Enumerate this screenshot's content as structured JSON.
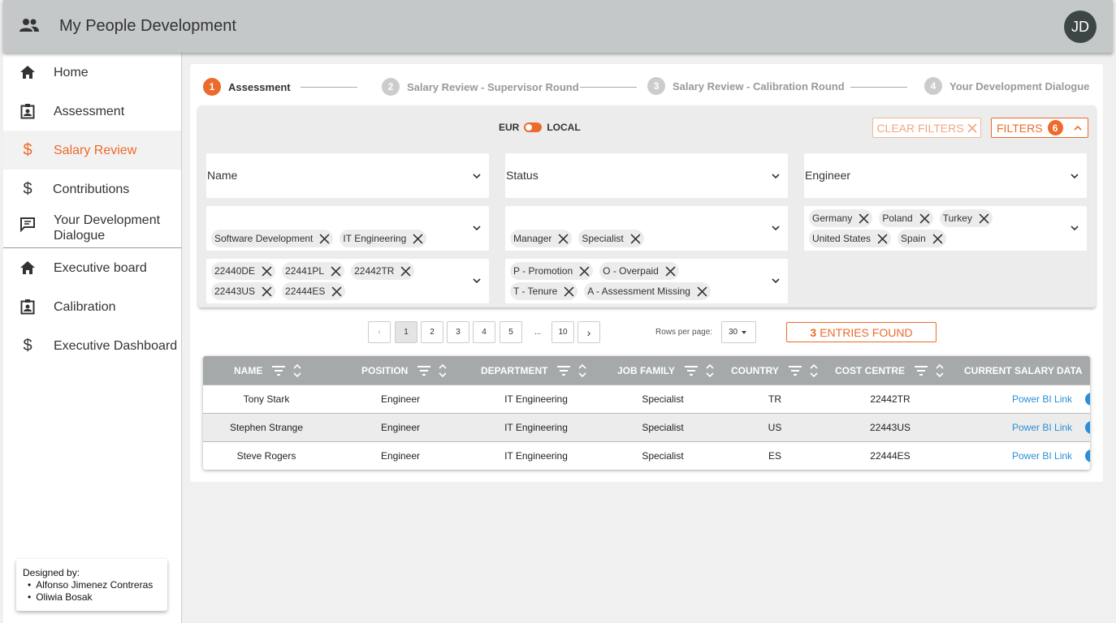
{
  "app": {
    "title": "My People Development",
    "avatar_initials": "JD",
    "accent": "#ec6a2c"
  },
  "sidebar": {
    "items": [
      {
        "label": "Home",
        "icon": "home-icon"
      },
      {
        "label": "Assessment",
        "icon": "badge-icon"
      },
      {
        "label": "Salary Review",
        "icon": "dollar-icon",
        "active": true
      },
      {
        "label": "Contributions",
        "icon": "dollar-icon"
      },
      {
        "label": "Your Development Dialogue",
        "icon": "chat-icon"
      },
      {
        "label": "Executive board",
        "icon": "home-icon"
      },
      {
        "label": "Calibration",
        "icon": "badge-icon"
      },
      {
        "label": "Executive Dashboard",
        "icon": "dollar-icon"
      }
    ],
    "designed_by": {
      "title": "Designed by:",
      "names": [
        "Alfonso Jimenez Contreras",
        "Oliwia Bosak"
      ]
    }
  },
  "stepper": [
    {
      "num": "1",
      "label": "Assessment",
      "active": true
    },
    {
      "num": "2",
      "label": "Salary Review - Supervisor Round"
    },
    {
      "num": "3",
      "label": "Salary Review - Calibration Round"
    },
    {
      "num": "4",
      "label": "Your Development Dialogue"
    }
  ],
  "filters": {
    "currency_left": "EUR",
    "currency_right": "LOCAL",
    "clear_label": "CLEAR FILTERS",
    "filters_label": "FILTERS",
    "filters_count": "6",
    "selects": {
      "name": "Name",
      "status": "Status",
      "engineer": "Engineer"
    },
    "departments": [
      "Software Development",
      "IT Engineering"
    ],
    "job_families": [
      "Manager",
      "Specialist"
    ],
    "countries": [
      "Germany",
      "Poland",
      "Turkey",
      "United States",
      "Spain"
    ],
    "cost_centres": [
      "22440DE",
      "22441PL",
      "22442TR",
      "22443US",
      "22444ES"
    ],
    "flags": [
      "P - Promotion",
      "O - Overpaid",
      "T - Tenure",
      "A - Assessment Missing"
    ]
  },
  "pagination": {
    "prev": "‹",
    "pages": [
      "1",
      "2",
      "3",
      "4",
      "5"
    ],
    "ellipsis": "...",
    "last": "10",
    "next": "›",
    "current": "1",
    "rows_label": "Rows per page:",
    "rows_value": "30",
    "entries_count": "3",
    "entries_label": "ENTRIES FOUND"
  },
  "table": {
    "columns": [
      "NAME",
      "POSITION",
      "DEPARTMENT",
      "JOB FAMILY",
      "COUNTRY",
      "COST CENTRE",
      "CURRENT SALARY DATA"
    ],
    "rows": [
      [
        "Tony Stark",
        "Engineer",
        "IT Engineering",
        "Specialist",
        "TR",
        "22442TR",
        "Power BI Link"
      ],
      [
        "Stephen Strange",
        "Engineer",
        "IT Engineering",
        "Specialist",
        "US",
        "22443US",
        "Power BI Link"
      ],
      [
        "Steve Rogers",
        "Engineer",
        "IT Engineering",
        "Specialist",
        "ES",
        "22444ES",
        "Power BI Link"
      ]
    ]
  }
}
